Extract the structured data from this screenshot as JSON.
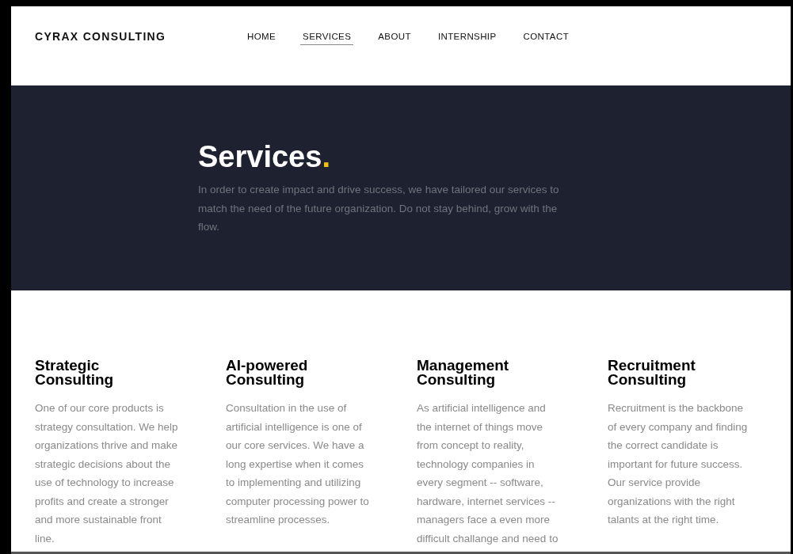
{
  "header": {
    "brand": "CYRAX CONSULTING",
    "nav": [
      {
        "label": "HOME",
        "selected": false
      },
      {
        "label": "SERVICES",
        "selected": true
      },
      {
        "label": "ABOUT",
        "selected": false
      },
      {
        "label": "INTERNSHIP",
        "selected": false
      },
      {
        "label": "CONTACT",
        "selected": false
      }
    ]
  },
  "hero": {
    "title": "Services",
    "title_mark": ".",
    "lines": [
      "In order to create impact and drive success, we have tailored our services to",
      "match the need of the future organization. Do not stay behind, grow with the",
      "flow."
    ]
  },
  "services": [
    {
      "title": [
        "Strategic",
        "Consulting"
      ],
      "lines": [
        "One of our core products is",
        "strategy consultation. We help",
        "organizations thrive and make",
        "strategic decisions about the",
        "use of technology to increase",
        "profits and create a stronger",
        "and more sustainable front",
        "line."
      ]
    },
    {
      "title": [
        "AI-powered",
        "Consulting"
      ],
      "lines": [
        "Consultation in the use of",
        "artificial intelligence is one of",
        "our core services. We have a",
        "long expertise when it comes",
        "to implementing and utilizing",
        "computer processing power to",
        "streamline processes."
      ]
    },
    {
      "title": [
        "Management",
        "Consulting"
      ],
      "lines": [
        "As artificial intelligence and",
        "the internet of things move",
        "from concept to reality,",
        "technology companies in",
        "every segment -- software,",
        "hardware, internet services --",
        "managers face a even more",
        "difficult challange and need to"
      ]
    },
    {
      "title": [
        "Recruitment",
        "Consulting"
      ],
      "lines": [
        "Recruitment is the backbone",
        "of every company and finding",
        "the correct candidate is",
        "important for future success.",
        "Our service provide",
        "organizations with the right",
        "talants at the right time."
      ]
    }
  ]
}
